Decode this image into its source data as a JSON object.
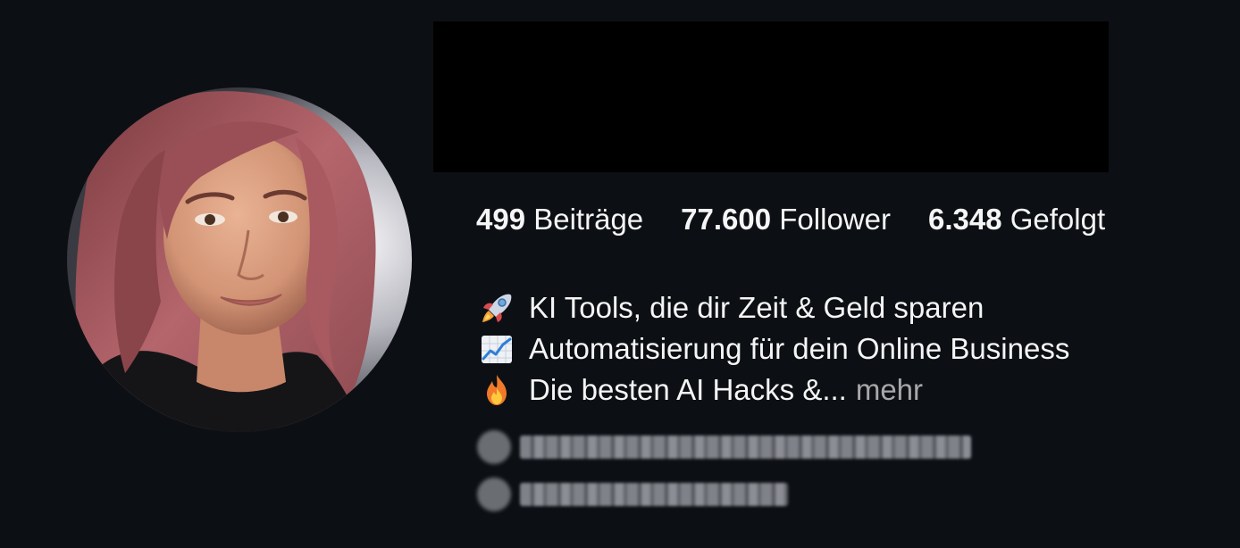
{
  "profile": {
    "avatar_icon": "profile-photo",
    "stats": [
      {
        "count": "499",
        "label": "Beiträge"
      },
      {
        "count": "77.600",
        "label": "Follower"
      },
      {
        "count": "6.348",
        "label": "Gefolgt"
      }
    ],
    "bio": {
      "lines": [
        {
          "icon": "rocket-emoji-icon",
          "text": "KI Tools, die dir Zeit & Geld sparen"
        },
        {
          "icon": "chart-increasing-emoji-icon",
          "text": "Automatisierung für dein Online Business"
        },
        {
          "icon": "fire-emoji-icon",
          "text": "Die besten AI Hacks &..."
        }
      ],
      "more_label": "mehr"
    },
    "blurred_rows": [
      {
        "icon": "link-icon"
      },
      {
        "icon": "threads-icon"
      }
    ]
  },
  "colors": {
    "background": "#0c1014",
    "text_primary": "#f5f5f5",
    "text_secondary": "#a8a8a8",
    "redaction": "#000000"
  }
}
